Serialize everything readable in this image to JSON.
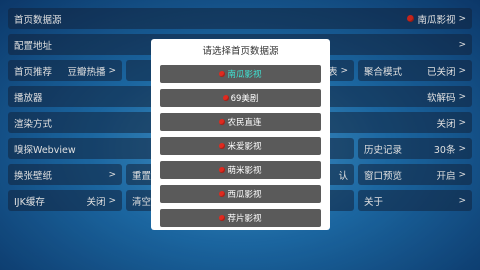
{
  "rows": {
    "home_source": {
      "label": "首页数据源",
      "value": "南瓜影视",
      "chev": ">"
    },
    "config_url": {
      "label": "配置地址",
      "chev": ">"
    },
    "home_recommend": {
      "label": "首页推荐",
      "value": "豆瓣热播",
      "chev": ">"
    },
    "player": {
      "label": "播放器",
      "value": "软解码",
      "chev": ">"
    },
    "render_mode": {
      "label": "渲染方式",
      "value": "关闭",
      "chev": ">"
    },
    "sniff_webview": {
      "label": "嗅探Webview",
      "chev": ">"
    },
    "wallpaper": {
      "label": "换张壁纸",
      "chev": ">"
    },
    "reset_hint": {
      "label": "重置"
    },
    "ijk_cache": {
      "label": "IJK缓存",
      "value": "关闭",
      "chev": ">"
    },
    "clear_hint": {
      "label": "清空"
    },
    "mode_hint": {
      "label": "表",
      "chev": ">"
    },
    "aggregate_mode": {
      "label": "聚合模式",
      "value": "已关闭",
      "chev": ">"
    },
    "history": {
      "label": "历史记录",
      "value": "30条",
      "chev": ">"
    },
    "window_preview": {
      "label": "窗口预览",
      "value": "开启",
      "chev": ">"
    },
    "about": {
      "label": "关于",
      "chev": ">"
    },
    "hidden_suffix": {
      "label": "认"
    }
  },
  "dialog": {
    "title": "请选择首页数据源",
    "options": [
      {
        "label": "南瓜影视",
        "selected": true
      },
      {
        "label": "69美剧",
        "selected": false
      },
      {
        "label": "农民直连",
        "selected": false
      },
      {
        "label": "米爱影视",
        "selected": false
      },
      {
        "label": "萌米影视",
        "selected": false
      },
      {
        "label": "西瓜影视",
        "selected": false
      },
      {
        "label": "荐片影视",
        "selected": false
      }
    ]
  },
  "colors": {
    "dot": "#e02a1f",
    "selected_text": "#3fe4d4",
    "option_bg": "#5a5a5a"
  }
}
